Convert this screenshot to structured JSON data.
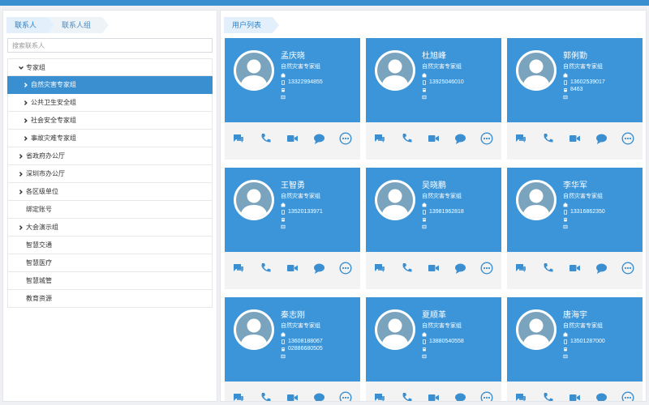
{
  "left_panel": {
    "tabs": [
      "联系人",
      "联系人组"
    ],
    "search_placeholder": "搜索联系人",
    "tree": [
      {
        "label": "专家组",
        "chevron": "down",
        "level": 0
      },
      {
        "label": "自然灾害专家组",
        "chevron": "right",
        "level": 1,
        "active": true
      },
      {
        "label": "公共卫生安全组",
        "chevron": "right",
        "level": 1
      },
      {
        "label": "社会安全专家组",
        "chevron": "right",
        "level": 1
      },
      {
        "label": "事故灾难专家组",
        "chevron": "right",
        "level": 1
      },
      {
        "label": "省政府办公厅",
        "chevron": "right",
        "level": 0
      },
      {
        "label": "深圳市办公厅",
        "chevron": "right",
        "level": 0
      },
      {
        "label": "各区级单位",
        "chevron": "right",
        "level": 0
      },
      {
        "label": "绑定账号",
        "chevron": "",
        "level": 0
      },
      {
        "label": "大会演示组",
        "chevron": "right",
        "level": 0
      },
      {
        "label": "智慧交通",
        "chevron": "",
        "level": 0
      },
      {
        "label": "智慧医疗",
        "chevron": "",
        "level": 0
      },
      {
        "label": "智慧城管",
        "chevron": "",
        "level": 0
      },
      {
        "label": "教育资源",
        "chevron": "",
        "level": 0
      }
    ]
  },
  "right_panel": {
    "tab": "用户列表",
    "users": [
      {
        "name": "孟庆晓",
        "dept": "自然灾害专家组",
        "phone": "13322994855",
        "tel": "",
        "fax": ""
      },
      {
        "name": "杜旭峰",
        "dept": "自然灾害专家组",
        "phone": "13925046010",
        "tel": "",
        "fax": ""
      },
      {
        "name": "郭俐勤",
        "dept": "自然灾害专家组",
        "phone": "13602539017",
        "tel": "8463",
        "fax": ""
      },
      {
        "name": "王智勇",
        "dept": "自然灾害专家组",
        "phone": "13520133971",
        "tel": "",
        "fax": ""
      },
      {
        "name": "吴晓鹏",
        "dept": "自然灾害专家组",
        "phone": "13981962818",
        "tel": "",
        "fax": ""
      },
      {
        "name": "李华军",
        "dept": "自然灾害专家组",
        "phone": "13316862350",
        "tel": "",
        "fax": ""
      },
      {
        "name": "秦志刚",
        "dept": "自然灾害专家组",
        "phone": "13608188067",
        "tel": "02886680505",
        "fax": ""
      },
      {
        "name": "夏顺革",
        "dept": "自然灾害专家组",
        "phone": "13880540558",
        "tel": "",
        "fax": ""
      },
      {
        "name": "唐海宇",
        "dept": "自然灾害专家组",
        "phone": "13501287000",
        "tel": "",
        "fax": ""
      }
    ]
  },
  "colors": {
    "primary": "#3b95d8",
    "topbar": "#3a8fd1",
    "icon": "#3a8fd1"
  },
  "icons": {
    "card_info": [
      "building-icon",
      "mobile-phone-icon",
      "telephone-icon",
      "fax-icon"
    ],
    "card_actions": [
      "chat-icon",
      "phone-call-icon",
      "video-call-icon",
      "message-icon",
      "more-icon"
    ]
  }
}
